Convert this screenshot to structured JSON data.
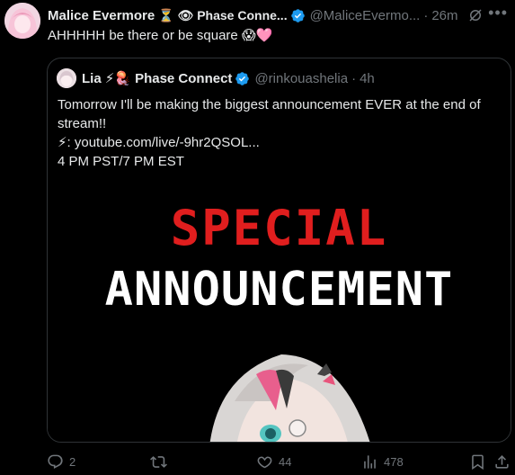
{
  "tweet": {
    "author_name": "Malice Evermore",
    "author_emoji": "⏳ 👁 Phase Conne...",
    "handle": "@MaliceEvermo...",
    "separator": "·",
    "time": "26m",
    "more_icon": "more-dots-icon",
    "text": "AHHHHH be there or be square 😱🩷"
  },
  "quote": {
    "author_name": "Lia",
    "author_emoji": "⚡🪼 Phase Connect",
    "handle": "@rinkouashelia",
    "separator": "·",
    "time": "4h",
    "lines": [
      "Tomorrow I'll be making the biggest announcement EVER at the end of",
      "stream!!",
      "⚡: youtube.com/live/-9hr2QSOL...",
      "4 PM PST/7 PM EST"
    ],
    "image": {
      "line1": "SPECIAL",
      "line2": "ANNOUNCEMENT"
    }
  },
  "actions": {
    "replies": "2",
    "retweets": "",
    "likes": "44",
    "views": "478"
  },
  "colors": {
    "background": "#000000",
    "text": "#e7e9ea",
    "muted": "#71767b",
    "verified": "#1d9bf0",
    "special_red": "#e01e1e"
  }
}
